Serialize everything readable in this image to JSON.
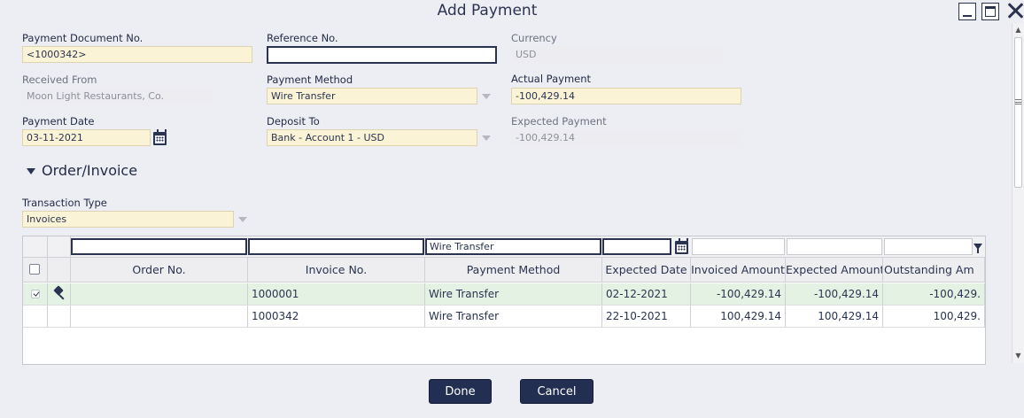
{
  "window": {
    "title": "Add Payment"
  },
  "form": {
    "payment_document_no": {
      "label": "Payment Document No.",
      "value": "<1000342>"
    },
    "reference_no": {
      "label": "Reference No.",
      "value": ""
    },
    "currency": {
      "label": "Currency",
      "value": "USD"
    },
    "received_from": {
      "label": "Received From",
      "value": "Moon Light Restaurants, Co."
    },
    "payment_method": {
      "label": "Payment Method",
      "value": "Wire Transfer"
    },
    "actual_payment": {
      "label": "Actual Payment",
      "value": "-100,429.14"
    },
    "payment_date": {
      "label": "Payment Date",
      "value": "03-11-2021"
    },
    "deposit_to": {
      "label": "Deposit To",
      "value": "Bank - Account 1 - USD"
    },
    "expected_payment": {
      "label": "Expected Payment",
      "value": "-100,429.14"
    }
  },
  "section": {
    "title": "Order/Invoice",
    "expanded": true
  },
  "transaction_type": {
    "label": "Transaction Type",
    "value": "Invoices"
  },
  "grid": {
    "filters": {
      "order_no": "",
      "invoice_no": "",
      "payment_method": "Wire Transfer",
      "expected_date": "",
      "invoiced_amount": "",
      "expected_amount": "",
      "outstanding_amount": ""
    },
    "columns": [
      "Order No.",
      "Invoice No.",
      "Payment Method",
      "Expected Date",
      "Invoiced Amount",
      "Expected Amount",
      "Outstanding Am"
    ],
    "rows": [
      {
        "selected": true,
        "pinned": true,
        "order_no": "",
        "invoice_no": "1000001",
        "payment_method": "Wire Transfer",
        "expected_date": "02-12-2021",
        "invoiced_amount": "-100,429.14",
        "expected_amount": "-100,429.14",
        "outstanding_amount": "-100,429."
      },
      {
        "selected": false,
        "pinned": false,
        "order_no": "",
        "invoice_no": "1000342",
        "payment_method": "Wire Transfer",
        "expected_date": "22-10-2021",
        "invoiced_amount": "100,429.14",
        "expected_amount": "100,429.14",
        "outstanding_amount": "100,429."
      }
    ]
  },
  "buttons": {
    "done": "Done",
    "cancel": "Cancel"
  },
  "colors": {
    "accent": "#232f52",
    "field_bg": "#fbf3d6",
    "selected_row": "#e4f2e4",
    "background": "#ededf4"
  }
}
